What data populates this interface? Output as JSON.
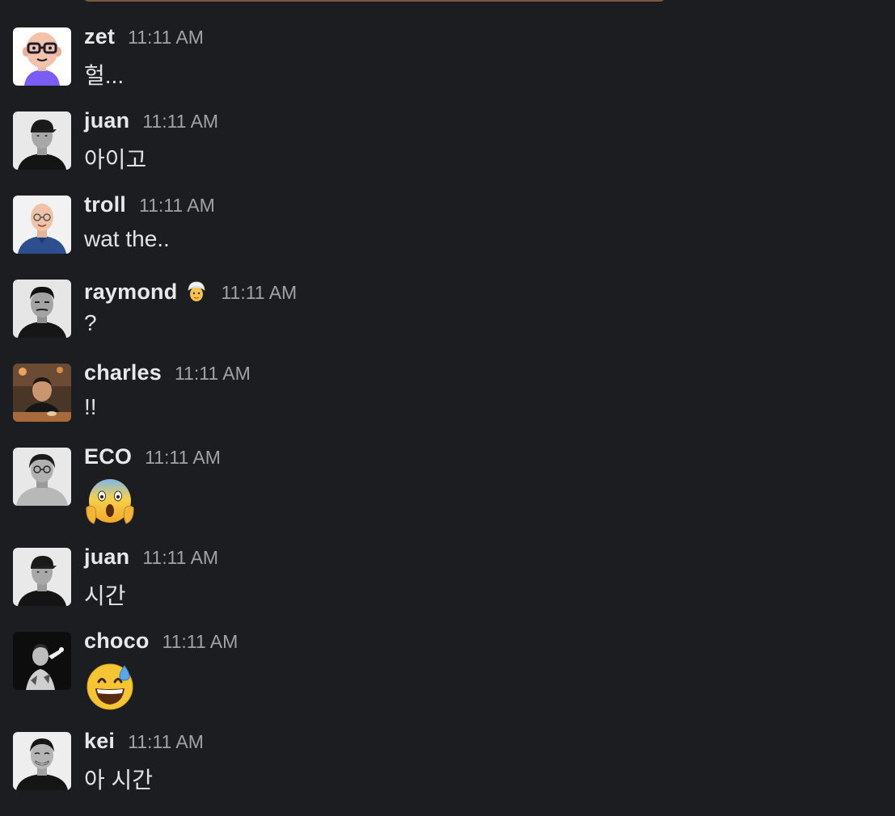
{
  "messages": [
    {
      "name": "zet",
      "time": "11:11 AM",
      "text": "헐..."
    },
    {
      "name": "juan",
      "time": "11:11 AM",
      "text": "아이고"
    },
    {
      "name": "troll",
      "time": "11:11 AM",
      "text": "wat the.."
    },
    {
      "name": "raymond",
      "time": "11:11 AM",
      "text": "?",
      "status_icon": "person-with-turban-icon"
    },
    {
      "name": "charles",
      "time": "11:11 AM",
      "text": "!!"
    },
    {
      "name": "ECO",
      "time": "11:11 AM",
      "emoji": "face-screaming-in-fear-icon"
    },
    {
      "name": "juan",
      "time": "11:11 AM",
      "text": "시간"
    },
    {
      "name": "choco",
      "time": "11:11 AM",
      "emoji": "grinning-face-with-sweat-icon"
    },
    {
      "name": "kei",
      "time": "11:11 AM",
      "text": "아 시간"
    }
  ],
  "colors": {
    "background": "#1b1d21",
    "name": "#e8e8e8",
    "timestamp": "#a0a2a6",
    "text": "#e3e3e3"
  }
}
